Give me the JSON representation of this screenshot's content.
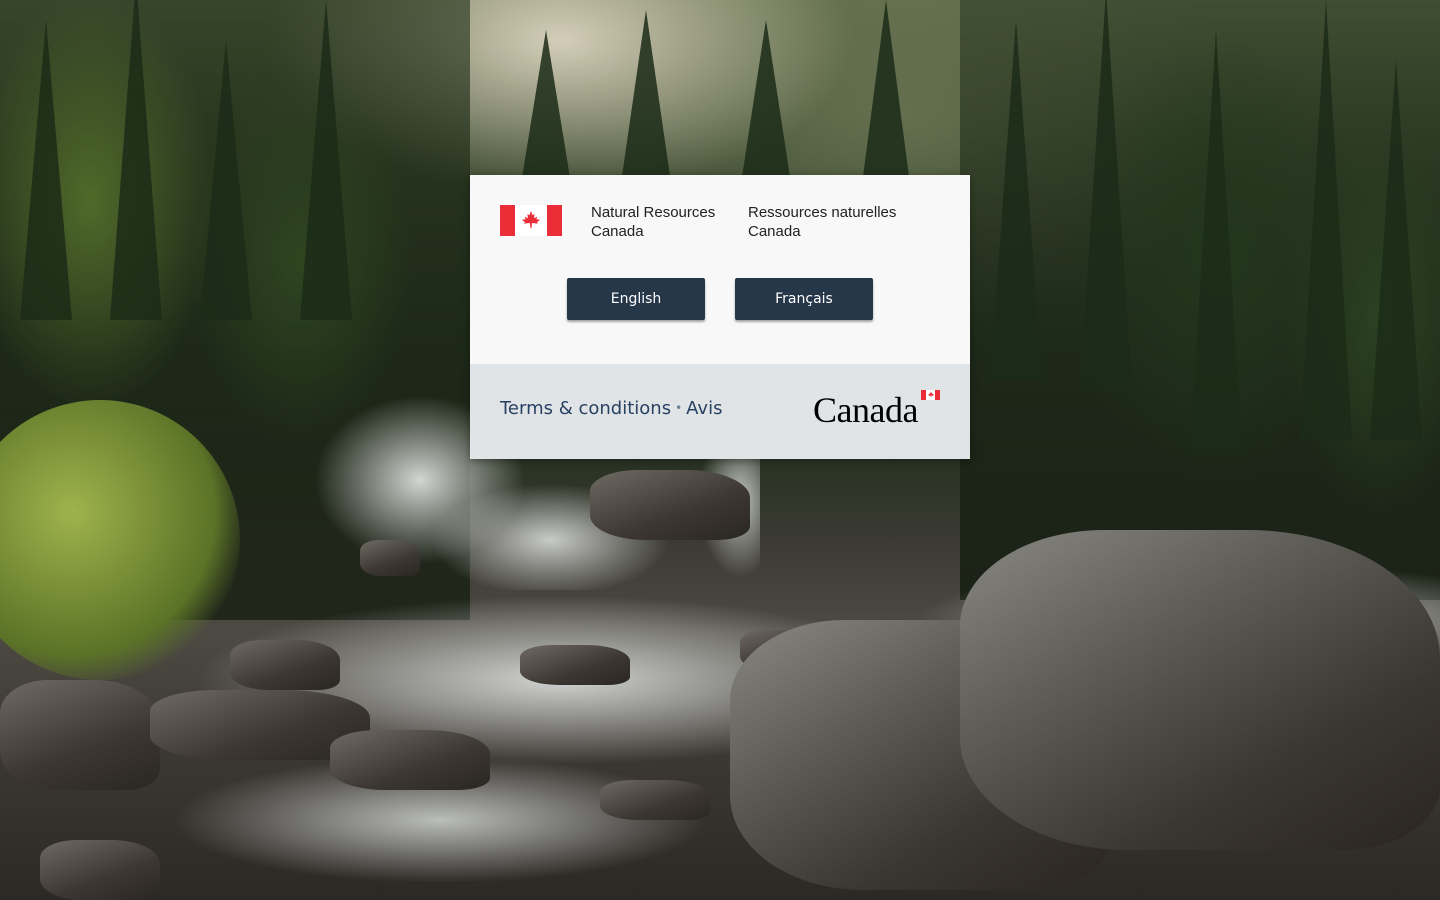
{
  "signature": {
    "en_line1": "Natural Resources",
    "en_line2": "Canada",
    "fr_line1": "Ressources naturelles",
    "fr_line2": "Canada"
  },
  "buttons": {
    "english": "English",
    "francais": "Français"
  },
  "footer": {
    "terms": "Terms & conditions",
    "separator": "•",
    "avis": "Avis"
  },
  "wordmark": {
    "text": "Canada"
  },
  "icons": {
    "flag": "canada-flag-icon",
    "wordmark_flag": "canada-wordmark-flag-icon"
  },
  "colors": {
    "button_bg": "#26374a",
    "flag_red": "#eb2d37",
    "footer_bg": "#e1e4e7",
    "card_bg": "#f8f8f8",
    "link": "#284162"
  }
}
